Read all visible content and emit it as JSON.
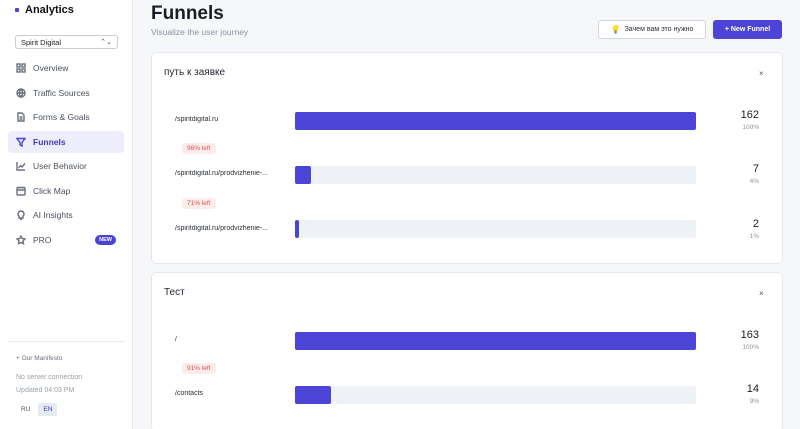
{
  "app": {
    "title": "Analytics"
  },
  "site_select": {
    "value": "Spirit Digital"
  },
  "sidebar": {
    "items": [
      {
        "label": "Overview",
        "icon": "grid-icon"
      },
      {
        "label": "Traffic Sources",
        "icon": "globe-icon"
      },
      {
        "label": "Forms & Goals",
        "icon": "document-icon"
      },
      {
        "label": "Funnels",
        "icon": "funnel-icon",
        "active": true
      },
      {
        "label": "User Behavior",
        "icon": "chart-line-icon"
      },
      {
        "label": "Click Map",
        "icon": "calendar-icon"
      },
      {
        "label": "AI Insights",
        "icon": "lightbulb-icon"
      },
      {
        "label": "PRO",
        "icon": "star-icon",
        "badge": "NEW"
      }
    ],
    "manifesto": "+ Our Manifesto",
    "server_status": "No server connection",
    "updated": "Updated 04:03 PM",
    "languages": [
      "RU",
      "EN"
    ],
    "selected_language": "EN"
  },
  "header": {
    "title": "Funnels",
    "subtitle": "Visualize the user journey",
    "why_button": "Зачем вам это нужно",
    "new_button": "+ New Funnel"
  },
  "funnels": [
    {
      "name": "путь к заявке",
      "close": "×",
      "steps": [
        {
          "url": "/spiritdigital.ru",
          "count": "162",
          "percent": "100%",
          "fill": 1.0
        },
        {
          "url": "/spiritdigital.ru/prodvizhenie-...",
          "count": "7",
          "percent": "4%",
          "fill": 0.04
        },
        {
          "url": "/spiritdigital.ru/prodvizhenie-...",
          "count": "2",
          "percent": "1%",
          "fill": 0.01
        }
      ],
      "dropoffs": [
        "96% left",
        "71% left"
      ]
    },
    {
      "name": "Тест",
      "close": "×",
      "steps": [
        {
          "url": "/",
          "count": "163",
          "percent": "100%",
          "fill": 1.0
        },
        {
          "url": "/contacts",
          "count": "14",
          "percent": "9%",
          "fill": 0.09
        }
      ],
      "dropoffs": [
        "91% left"
      ]
    }
  ],
  "colors": {
    "accent": "#4b44d6",
    "track": "#eef1f6",
    "dropoff": "#d9534f"
  }
}
